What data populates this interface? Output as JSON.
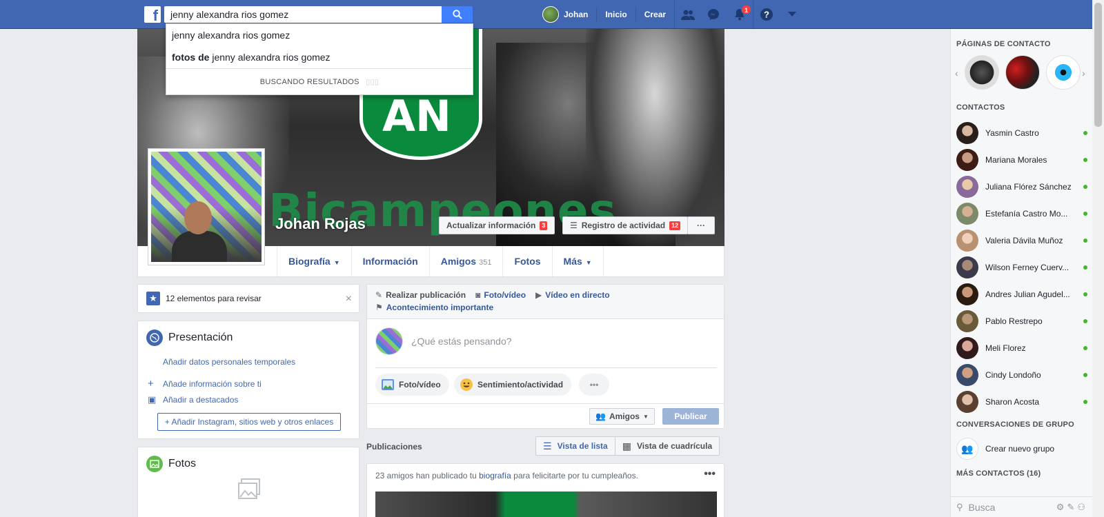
{
  "topbar": {
    "logo": "f",
    "search_value": "jenny alexandra rios gomez",
    "user_name": "Johan",
    "links": [
      "Inicio",
      "Crear"
    ],
    "notification_count": "1"
  },
  "dropdown": {
    "item1": "jenny alexandra rios gomez",
    "item2_bold": "fotos de",
    "item2_rest": " jenny alexandra rios gomez",
    "status": "BUSCANDO RESULTADOS"
  },
  "cover": {
    "name": "Johan Rojas",
    "update_label": "Actualizar información",
    "update_count": "3",
    "activity_label": "Registro de actividad",
    "activity_count": "12",
    "more": "···"
  },
  "tabs": {
    "bio": "Biografía",
    "info": "Información",
    "friends": "Amigos",
    "friends_count": "351",
    "photos": "Fotos",
    "more": "Más"
  },
  "review": {
    "text": "12 elementos para revisar",
    "close": "×"
  },
  "intro": {
    "title": "Presentación",
    "temp_link": "Añadir datos personales temporales",
    "add_info": "Añade información sobre ti",
    "add_featured": "Añadir a destacados",
    "add_links": "Añadir Instagram, sitios web y otros enlaces"
  },
  "photos_card": {
    "title": "Fotos"
  },
  "composer": {
    "make_post": "Realizar publicación",
    "photo_video": "Foto/vídeo",
    "live": "Vídeo en directo",
    "life_event": "Acontecimiento importante",
    "placeholder": "¿Qué estás pensando?",
    "pill_photo": "Foto/vídeo",
    "pill_feeling": "Sentimiento/actividad",
    "pill_more": "•••",
    "audience": "Amigos",
    "publish": "Publicar"
  },
  "posts": {
    "label": "Publicaciones",
    "list_view": "Vista de lista",
    "grid_view": "Vista de cuadrícula",
    "post_text_1": "23 amigos han publicado tu ",
    "post_link": "biografía",
    "post_text_2": " para felicitarte por tu cumpleaños.",
    "dots": "•••"
  },
  "sidebar": {
    "pages_header": "PÁGINAS DE CONTACTO",
    "contacts_header": "CONTACTOS",
    "contacts": [
      "Yasmin Castro",
      "Mariana Morales",
      "Juliana Flórez Sánchez",
      "Estefanía Castro Mo...",
      "Valeria Dávila Muñoz",
      "Wilson Ferney Cuerv...",
      "Andres Julian Agudel...",
      "Pablo Restrepo",
      "Meli Florez",
      "Cindy Londoño",
      "Sharon Acosta"
    ],
    "group_header": "CONVERSACIONES DE GRUPO",
    "new_group": "Crear nuevo grupo",
    "more_contacts": "MÁS CONTACTOS (16)",
    "search_placeholder": "Busca"
  },
  "colors": {
    "brand": "#4267b2",
    "online": "#42b72a",
    "badge": "#fa3e3e"
  }
}
